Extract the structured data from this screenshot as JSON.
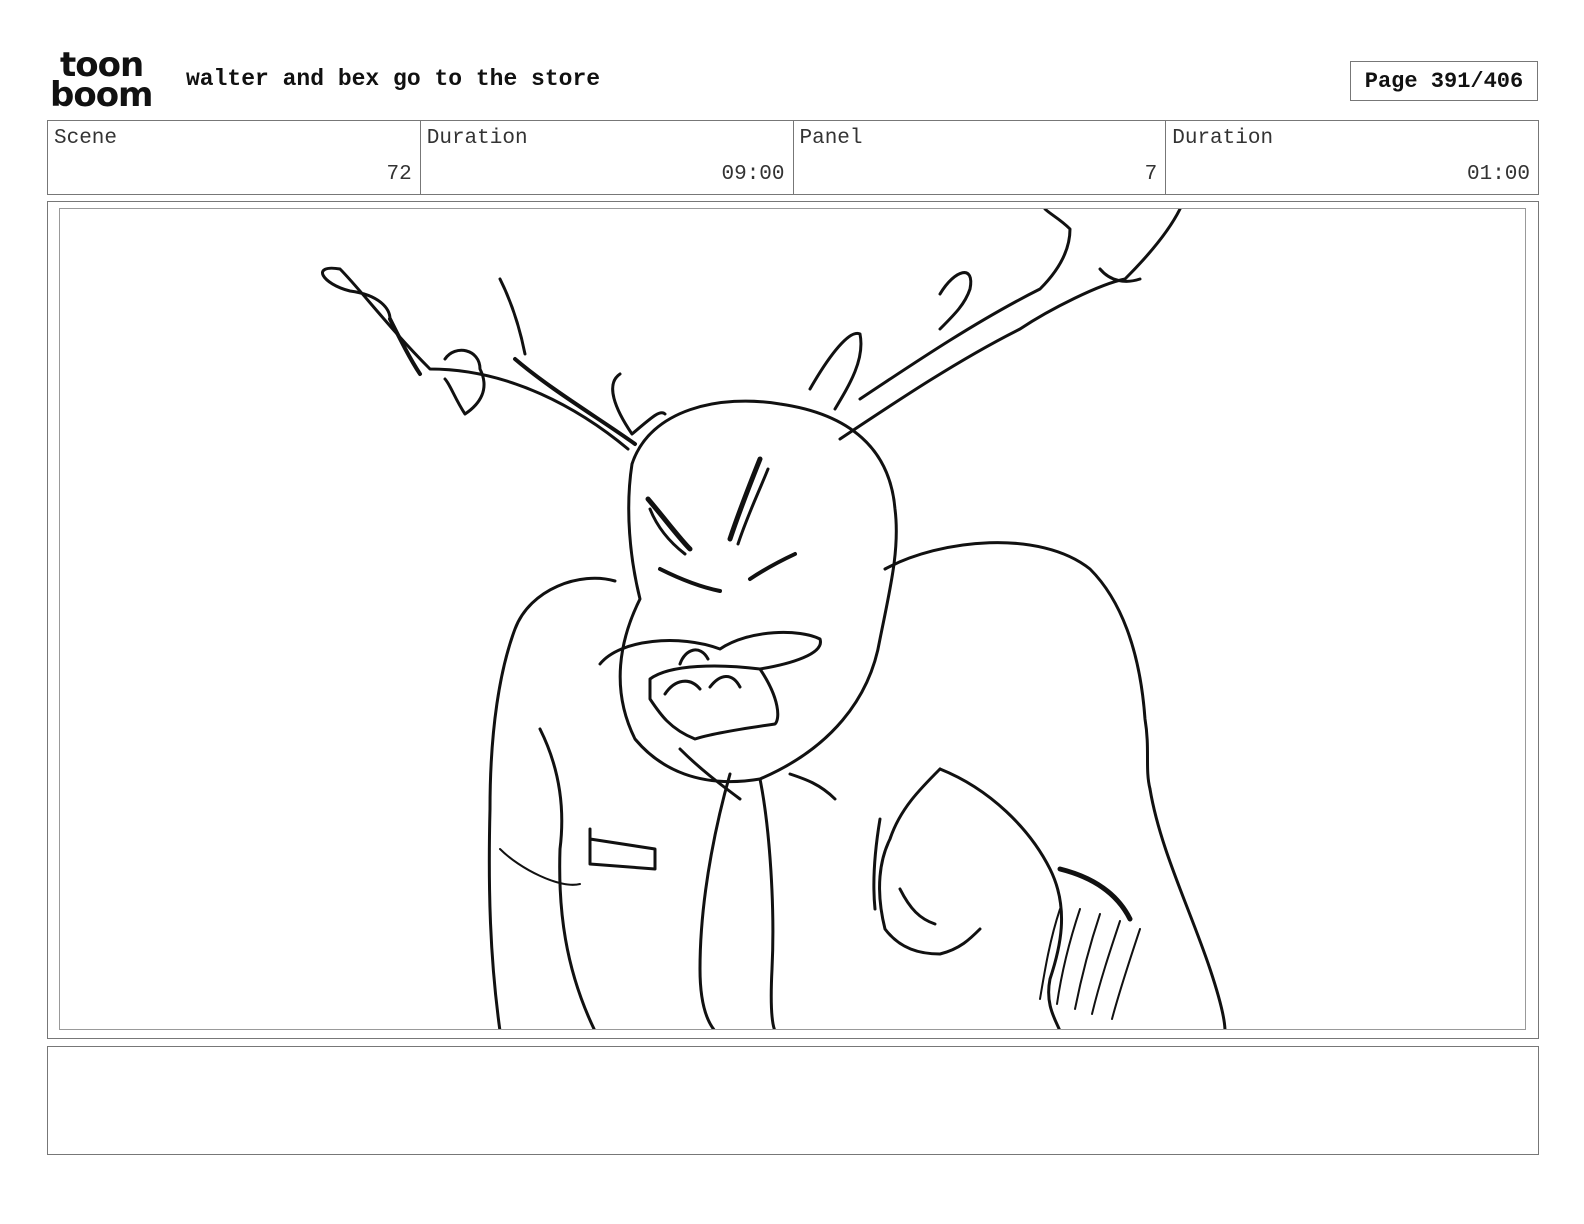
{
  "header": {
    "logo_top": "toon",
    "logo_bottom": "boom",
    "title": "walter and bex go to the store",
    "page_label": "Page 391/406"
  },
  "info": {
    "scene_label": "Scene",
    "scene_value": "72",
    "scene_duration_label": "Duration",
    "scene_duration_value": "09:00",
    "panel_label": "Panel",
    "panel_value": "7",
    "panel_duration_label": "Duration",
    "panel_duration_value": "01:00"
  },
  "notes": {
    "text": ""
  }
}
